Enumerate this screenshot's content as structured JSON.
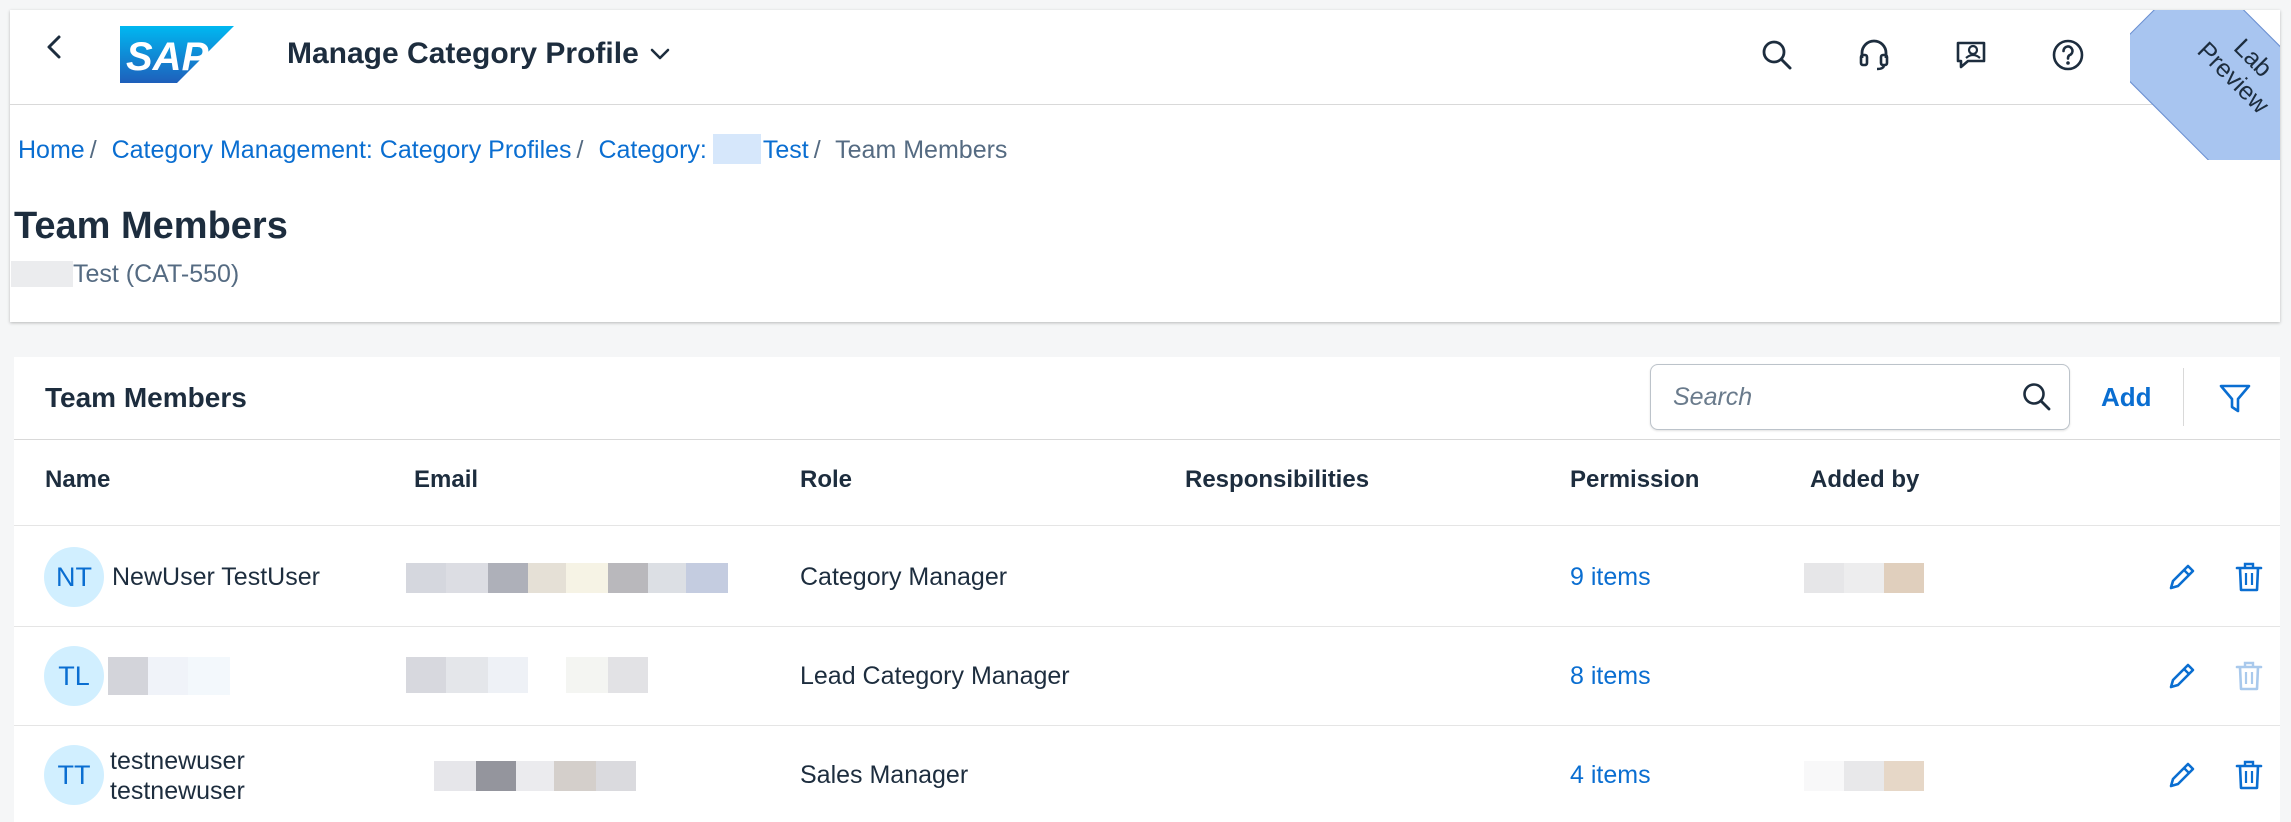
{
  "shell": {
    "logo_text": "SAP",
    "app_title": "Manage Category Profile",
    "ribbon": [
      "Lab",
      "Preview"
    ]
  },
  "breadcrumb": {
    "home": "Home",
    "category_profiles": "Category Management: Category Profiles",
    "category_prefix": "Category:",
    "category_suffix": "Test",
    "current": "Team Members"
  },
  "header": {
    "title": "Team Members",
    "subtitle": "Test (CAT-550)"
  },
  "table": {
    "title": "Team Members",
    "search_placeholder": "Search",
    "add_label": "Add",
    "columns": {
      "name": "Name",
      "email": "Email",
      "role": "Role",
      "responsibilities": "Responsibilities",
      "permission": "Permission",
      "added_by": "Added by"
    },
    "rows": [
      {
        "initials": "NT",
        "name_line1": "NewUser TestUser",
        "name_line2": "",
        "role": "Category Manager",
        "permission": "9 items",
        "delete_enabled": true
      },
      {
        "initials": "TL",
        "name_line1": "",
        "name_line2": "",
        "role": "Lead Category Manager",
        "permission": "8 items",
        "delete_enabled": false
      },
      {
        "initials": "TT",
        "name_line1": "testnewuser",
        "name_line2": "testnewuser",
        "role": "Sales Manager",
        "permission": "4 items",
        "delete_enabled": true
      }
    ]
  },
  "colors": {
    "accent": "#0a6ed1",
    "text": "#1d2d3e",
    "avatar_bg": "#d1efff",
    "ribbon": "#a8c5f0",
    "disabled_icon": "#a9c9ec"
  },
  "icons": {
    "back": "chevron-left-icon",
    "search": "search-icon",
    "support": "headset-icon",
    "feedback": "chat-feedback-icon",
    "help": "help-icon",
    "notifications": "bell-icon",
    "filter": "filter-icon",
    "edit": "pencil-icon",
    "delete": "trash-icon"
  }
}
